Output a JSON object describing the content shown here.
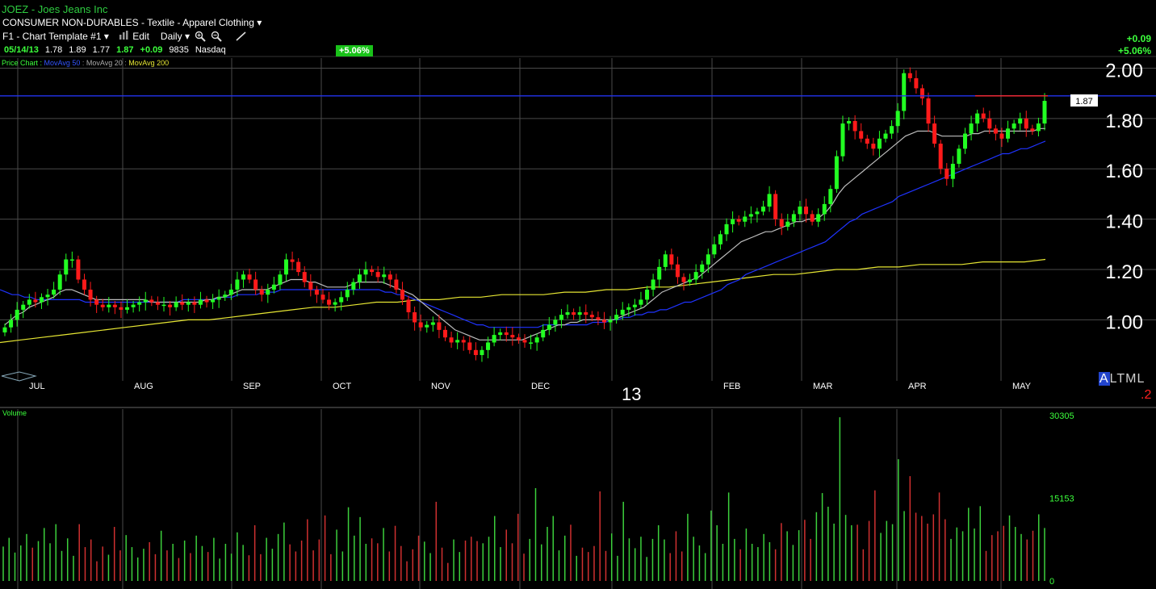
{
  "header": {
    "ticker_line": "JOEZ - Joes Jeans Inc",
    "sector_line": "CONSUMER NON-DURABLES - Textile - Apparel Clothing",
    "template_label": "F1 - Chart Template #1",
    "edit_label": "Edit",
    "period_label": "Daily"
  },
  "quote": {
    "date": "05/14/13",
    "open": "1.78",
    "high": "1.89",
    "low": "1.77",
    "close": "1.87",
    "change": "+0.09",
    "volume": "9835",
    "exchange": "Nasdaq",
    "pct_badge": "+5.06%"
  },
  "right_panel": {
    "change": "+0.09",
    "pct": "+5.06%",
    "last_price_tag": "1.87",
    "altml": "ALTML",
    "footnote": ".2"
  },
  "legend": {
    "label": "Price Chart",
    "sep": " : ",
    "ma50": "MovAvg 50",
    "ma20": "MovAvg 20",
    "ma200": "MovAvg 200"
  },
  "colors": {
    "background": "#000000",
    "up": "#22ff22",
    "down": "#ff1a1a",
    "ma50": "#1f33ff",
    "ma20": "#bdbdbd",
    "ma200": "#e6e633",
    "hline": "#2233ee",
    "grid": "#4a4a4a",
    "vol_up": "#3cd03c",
    "vol_down": "#d03030"
  },
  "chart_data": {
    "type": "candlestick",
    "ylim": [
      0.78,
      2.04
    ],
    "yticks": [
      "2.00",
      "1.80",
      "1.60",
      "1.40",
      "1.20",
      "1.00"
    ],
    "y_axis_values": [
      2.0,
      1.8,
      1.6,
      1.4,
      1.2,
      1.0
    ],
    "months": [
      "JUL",
      "AUG",
      "SEP",
      "OCT",
      "NOV",
      "DEC",
      "13",
      "FEB",
      "MAR",
      "APR",
      "MAY"
    ],
    "horizontal_line": 1.89,
    "last_price": 1.87,
    "close_series": [
      0.97,
      1.0,
      1.04,
      1.06,
      1.08,
      1.07,
      1.09,
      1.1,
      1.12,
      1.18,
      1.24,
      1.24,
      1.16,
      1.12,
      1.08,
      1.06,
      1.05,
      1.06,
      1.05,
      1.04,
      1.05,
      1.06,
      1.07,
      1.08,
      1.07,
      1.06,
      1.06,
      1.05,
      1.07,
      1.06,
      1.07,
      1.06,
      1.08,
      1.07,
      1.08,
      1.09,
      1.1,
      1.12,
      1.16,
      1.18,
      1.16,
      1.12,
      1.1,
      1.12,
      1.14,
      1.18,
      1.24,
      1.23,
      1.19,
      1.15,
      1.12,
      1.1,
      1.08,
      1.06,
      1.07,
      1.09,
      1.12,
      1.15,
      1.18,
      1.2,
      1.19,
      1.17,
      1.18,
      1.16,
      1.12,
      1.08,
      1.03,
      0.99,
      0.97,
      0.98,
      0.99,
      0.96,
      0.93,
      0.91,
      0.92,
      0.91,
      0.88,
      0.86,
      0.88,
      0.91,
      0.94,
      0.95,
      0.94,
      0.93,
      0.92,
      0.91,
      0.91,
      0.93,
      0.96,
      0.98,
      1.0,
      1.02,
      1.03,
      1.02,
      1.03,
      1.02,
      1.01,
      1.0,
      0.99,
      1.0,
      1.02,
      1.04,
      1.05,
      1.06,
      1.08,
      1.12,
      1.16,
      1.21,
      1.26,
      1.22,
      1.17,
      1.15,
      1.16,
      1.19,
      1.22,
      1.26,
      1.3,
      1.34,
      1.38,
      1.4,
      1.39,
      1.41,
      1.42,
      1.43,
      1.45,
      1.5,
      1.4,
      1.37,
      1.39,
      1.42,
      1.45,
      1.42,
      1.39,
      1.42,
      1.46,
      1.52,
      1.65,
      1.78,
      1.79,
      1.75,
      1.72,
      1.7,
      1.68,
      1.72,
      1.74,
      1.77,
      1.83,
      1.98,
      1.96,
      1.92,
      1.88,
      1.78,
      1.7,
      1.6,
      1.56,
      1.62,
      1.68,
      1.74,
      1.78,
      1.82,
      1.8,
      1.76,
      1.74,
      1.72,
      1.76,
      1.78,
      1.8,
      1.76,
      1.75,
      1.78,
      1.87
    ],
    "ma20_series": [
      0.98,
      1.0,
      1.02,
      1.03,
      1.05,
      1.06,
      1.07,
      1.08,
      1.09,
      1.11,
      1.12,
      1.12,
      1.11,
      1.1,
      1.09,
      1.08,
      1.08,
      1.08,
      1.08,
      1.08,
      1.08,
      1.08,
      1.08,
      1.08,
      1.07,
      1.07,
      1.07,
      1.07,
      1.07,
      1.07,
      1.07,
      1.07,
      1.07,
      1.08,
      1.08,
      1.09,
      1.09,
      1.1,
      1.11,
      1.12,
      1.12,
      1.12,
      1.12,
      1.12,
      1.13,
      1.14,
      1.15,
      1.16,
      1.16,
      1.16,
      1.15,
      1.15,
      1.14,
      1.13,
      1.13,
      1.13,
      1.13,
      1.14,
      1.15,
      1.15,
      1.15,
      1.15,
      1.15,
      1.14,
      1.13,
      1.12,
      1.11,
      1.1,
      1.08,
      1.06,
      1.04,
      1.02,
      1.0,
      0.98,
      0.96,
      0.95,
      0.94,
      0.93,
      0.92,
      0.92,
      0.92,
      0.92,
      0.92,
      0.92,
      0.92,
      0.92,
      0.93,
      0.94,
      0.95,
      0.96,
      0.97,
      0.98,
      0.98,
      0.99,
      0.99,
      1.0,
      1.0,
      1.0,
      1.0,
      1.0,
      1.0,
      1.01,
      1.02,
      1.03,
      1.04,
      1.05,
      1.07,
      1.09,
      1.11,
      1.12,
      1.13,
      1.14,
      1.15,
      1.16,
      1.17,
      1.19,
      1.21,
      1.23,
      1.25,
      1.27,
      1.29,
      1.31,
      1.32,
      1.33,
      1.34,
      1.35,
      1.35,
      1.36,
      1.37,
      1.38,
      1.39,
      1.39,
      1.4,
      1.4,
      1.41,
      1.43,
      1.46,
      1.5,
      1.53,
      1.55,
      1.57,
      1.59,
      1.61,
      1.63,
      1.65,
      1.67,
      1.69,
      1.71,
      1.73,
      1.74,
      1.75,
      1.75,
      1.75,
      1.74,
      1.73,
      1.73,
      1.73,
      1.73,
      1.73,
      1.74,
      1.74,
      1.75,
      1.75,
      1.75,
      1.75,
      1.75,
      1.75,
      1.75,
      1.75,
      1.75,
      1.76,
      1.76
    ],
    "ma50_series": [
      1.12,
      1.11,
      1.1,
      1.1,
      1.09,
      1.09,
      1.08,
      1.08,
      1.08,
      1.08,
      1.08,
      1.08,
      1.08,
      1.08,
      1.07,
      1.07,
      1.07,
      1.07,
      1.07,
      1.07,
      1.07,
      1.07,
      1.07,
      1.07,
      1.07,
      1.07,
      1.07,
      1.07,
      1.07,
      1.07,
      1.08,
      1.08,
      1.08,
      1.08,
      1.08,
      1.08,
      1.09,
      1.09,
      1.09,
      1.1,
      1.1,
      1.1,
      1.1,
      1.11,
      1.11,
      1.11,
      1.12,
      1.12,
      1.12,
      1.12,
      1.12,
      1.12,
      1.12,
      1.12,
      1.12,
      1.12,
      1.12,
      1.12,
      1.12,
      1.12,
      1.12,
      1.12,
      1.12,
      1.11,
      1.11,
      1.1,
      1.1,
      1.09,
      1.08,
      1.07,
      1.06,
      1.05,
      1.04,
      1.03,
      1.02,
      1.01,
      1.0,
      0.99,
      0.98,
      0.98,
      0.97,
      0.97,
      0.97,
      0.97,
      0.97,
      0.97,
      0.97,
      0.97,
      0.97,
      0.98,
      0.98,
      0.98,
      0.98,
      0.98,
      0.98,
      0.98,
      0.98,
      0.99,
      0.99,
      0.99,
      1.0,
      1.0,
      1.01,
      1.01,
      1.02,
      1.02,
      1.03,
      1.03,
      1.04,
      1.04,
      1.05,
      1.06,
      1.07,
      1.07,
      1.08,
      1.09,
      1.1,
      1.11,
      1.12,
      1.14,
      1.15,
      1.16,
      1.18,
      1.19,
      1.2,
      1.21,
      1.22,
      1.23,
      1.24,
      1.25,
      1.26,
      1.27,
      1.28,
      1.29,
      1.3,
      1.31,
      1.33,
      1.35,
      1.37,
      1.39,
      1.4,
      1.42,
      1.43,
      1.44,
      1.45,
      1.46,
      1.47,
      1.49,
      1.5,
      1.51,
      1.52,
      1.53,
      1.54,
      1.55,
      1.56,
      1.57,
      1.58,
      1.59,
      1.6,
      1.61,
      1.62,
      1.63,
      1.64,
      1.65,
      1.66,
      1.66,
      1.67,
      1.68,
      1.68,
      1.69,
      1.7,
      1.71
    ],
    "ma200_series": [
      0.91,
      0.92,
      0.93,
      0.94,
      0.95,
      0.96,
      0.97,
      0.98,
      0.99,
      1.0,
      1.0,
      1.01,
      1.02,
      1.03,
      1.04,
      1.05,
      1.05,
      1.06,
      1.07,
      1.07,
      1.08,
      1.08,
      1.09,
      1.09,
      1.1,
      1.1,
      1.1,
      1.11,
      1.11,
      1.12,
      1.12,
      1.13,
      1.13,
      1.14,
      1.15,
      1.16,
      1.17,
      1.18,
      1.18,
      1.19,
      1.2,
      1.2,
      1.21,
      1.21,
      1.22,
      1.22,
      1.22,
      1.23,
      1.23,
      1.23,
      1.24
    ],
    "volume": {
      "yticks": [
        "30305",
        "15153",
        "0"
      ],
      "max": 30305,
      "bars": [
        6300,
        7900,
        5200,
        6500,
        8600,
        6100,
        7300,
        9700,
        6900,
        10400,
        5500,
        7800,
        4600,
        10400,
        6200,
        7600,
        3600,
        6300,
        4800,
        9900,
        5600,
        8400,
        6200,
        4300,
        5900,
        7100,
        4900,
        9200,
        5600,
        6800,
        4200,
        7400,
        5100,
        8300,
        6400,
        5300,
        7900,
        4100,
        6800,
        5000,
        8900,
        6600,
        4700,
        10200,
        4900,
        7900,
        5900,
        8600,
        10700,
        6700,
        5400,
        7400,
        11300,
        5600,
        7600,
        12000,
        4900,
        9400,
        5400,
        13500,
        8300,
        11700,
        6800,
        7800,
        6900,
        9700,
        5400,
        10100,
        6400,
        3600,
        5800,
        8300,
        7200,
        5100,
        14500,
        6100,
        3300,
        7600,
        5300,
        7400,
        8100,
        7300,
        6900,
        8100,
        11900,
        6200,
        9400,
        6900,
        12300,
        5000,
        7700,
        17000,
        6700,
        9900,
        11900,
        5600,
        8300,
        10300,
        4600,
        6100,
        5300,
        6400,
        16400,
        5500,
        8700,
        4600,
        14500,
        7800,
        6000,
        8100,
        4400,
        7700,
        10200,
        7600,
        5100,
        9100,
        5400,
        12300,
        8100,
        6500,
        5100,
        12900,
        10200,
        6800,
        16200,
        7700,
        5800,
        9600,
        6800,
        6200,
        8600,
        7100,
        5800,
        10600,
        9100,
        6600,
        9300,
        11200,
        7700,
        12600,
        16100,
        13600,
        10500,
        30000,
        12100,
        10200,
        10300,
        5800,
        11000,
        16600,
        8800,
        11000,
        10400,
        22300,
        12800,
        19200,
        12500,
        11900,
        10500,
        12200,
        16200,
        11300,
        7700,
        9800,
        9100,
        13400,
        9600,
        13700,
        5500,
        8400,
        9100,
        10100,
        12000,
        9900,
        8600,
        7600,
        9200,
        12200,
        9700
      ]
    }
  }
}
